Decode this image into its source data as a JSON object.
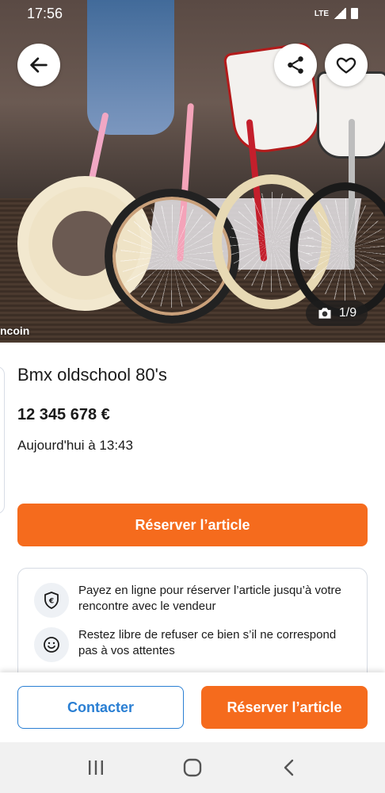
{
  "status_bar": {
    "time": "17:56",
    "network": "LTE"
  },
  "photo": {
    "counter": "1/9",
    "watermark": "ncoin"
  },
  "listing": {
    "title": "Bmx oldschool 80's",
    "price": "12 345 678 €",
    "date": "Aujourd'hui à 13:43"
  },
  "reserve_main_label": "Réserver l’article",
  "info": [
    {
      "icon": "euro-shield-icon",
      "text": "Payez en ligne pour réserver l’article jusqu’à votre rencontre avec le vendeur"
    },
    {
      "icon": "smile-icon",
      "text": "Restez libre de refuser ce bien s’il ne correspond pas à vos attentes"
    }
  ],
  "action_bar": {
    "contact_label": "Contacter",
    "reserve_label": "Réserver l’article"
  },
  "colors": {
    "accent_orange": "#f56b1d",
    "link_blue": "#2a7fd3"
  },
  "icons": [
    "back-arrow-icon",
    "share-icon",
    "heart-icon",
    "camera-icon",
    "recents-icon",
    "home-icon",
    "back-nav-icon"
  ]
}
